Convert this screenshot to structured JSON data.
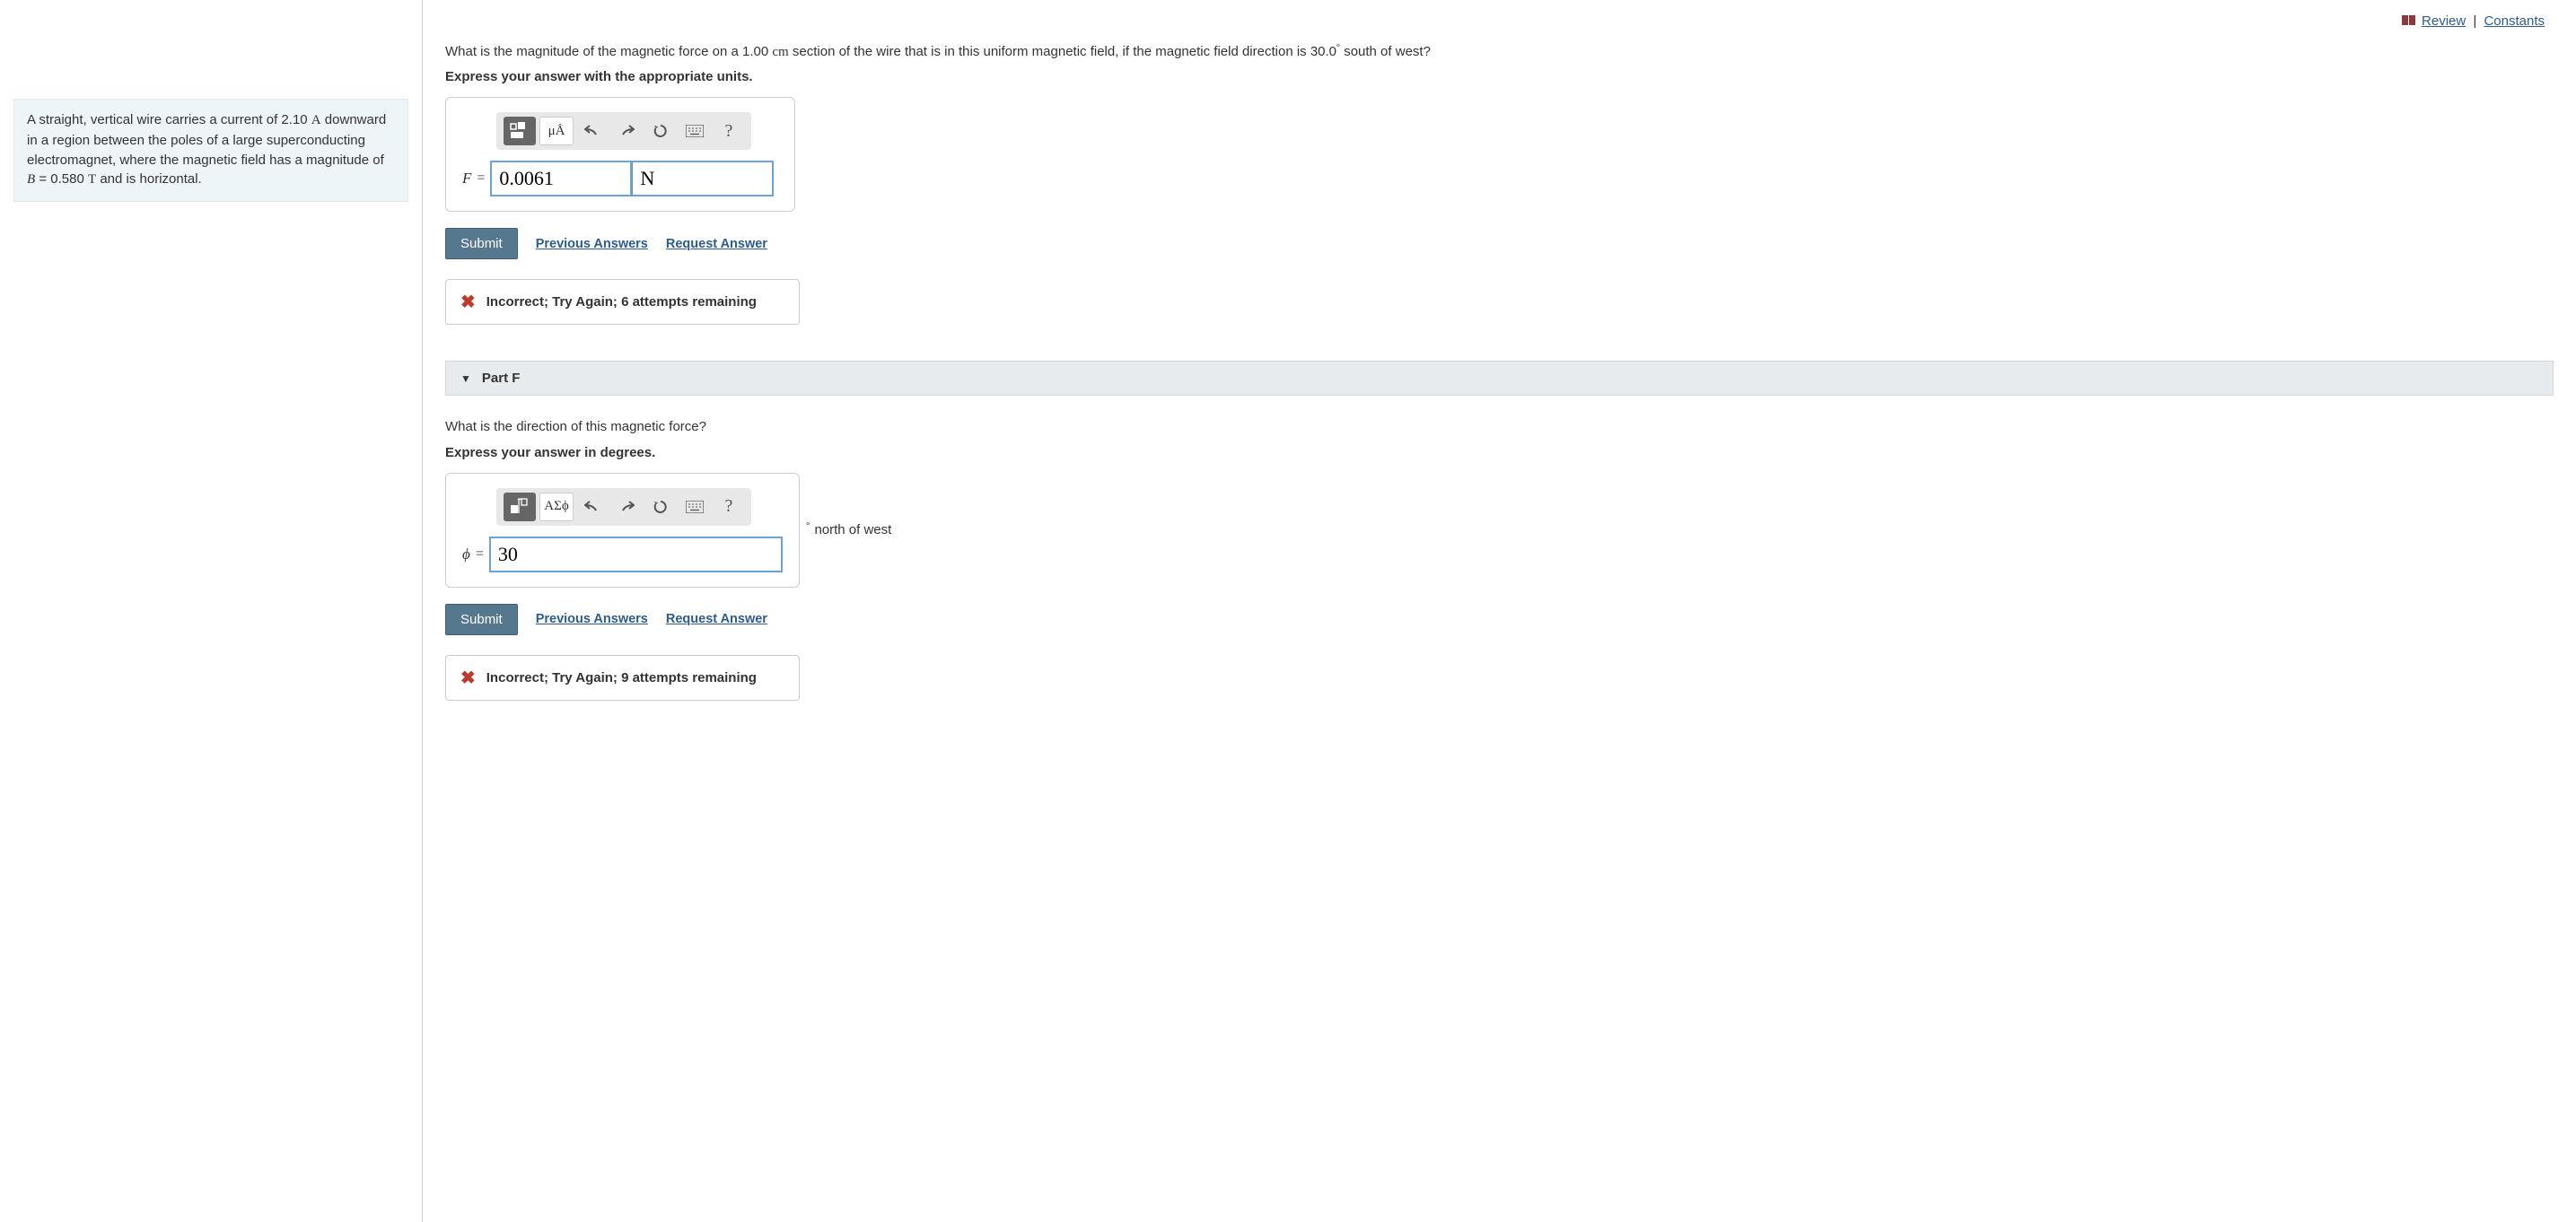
{
  "header": {
    "review": "Review",
    "constants": "Constants"
  },
  "problem": {
    "text_before_current": "A straight, vertical wire carries a current of 2.10 ",
    "current_unit": "A",
    "text_mid": " downward in a region between the poles of a large superconducting electromagnet, where the magnetic field has a magnitude of ",
    "b_var": "B",
    "eq": " = 0.580 ",
    "b_unit": "T",
    "text_end": " and is horizontal."
  },
  "partE": {
    "q1": "What is the magnitude of the magnetic force on a 1.00 ",
    "q_unit": "cm",
    "q2": " section of the wire that is in this uniform magnetic field, if the magnetic field direction is 30.0",
    "deg": "°",
    "q3": " south of west?",
    "instruction": "Express your answer with the appropriate units.",
    "var": "F",
    "eq": "=",
    "value": "0.0061",
    "unit": "N",
    "submit": "Submit",
    "prev": "Previous Answers",
    "req": "Request Answer",
    "feedback": "Incorrect; Try Again; 6 attempts remaining",
    "toolbar": {
      "special": "μÅ",
      "help": "?"
    }
  },
  "partF": {
    "title": "Part F",
    "q": "What is the direction of this magnetic force?",
    "instruction": "Express your answer in degrees.",
    "var": "ϕ",
    "eq": "=",
    "value": "30",
    "trail_deg": "∘",
    "trail_text": "north of west",
    "submit": "Submit",
    "prev": "Previous Answers",
    "req": "Request Answer",
    "feedback": "Incorrect; Try Again; 9 attempts remaining",
    "toolbar": {
      "special": "ΑΣϕ",
      "help": "?"
    }
  }
}
